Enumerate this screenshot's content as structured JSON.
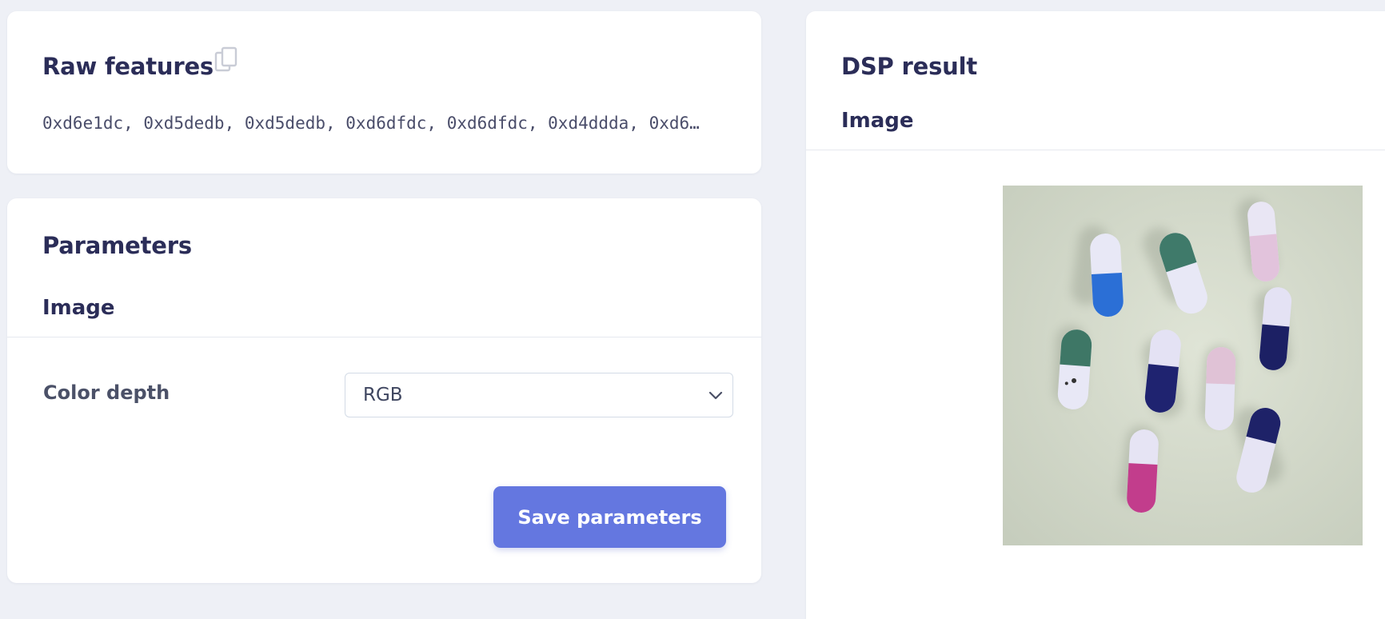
{
  "raw_features": {
    "title": "Raw features",
    "values_text": "0xd6e1dc, 0xd5dedb, 0xd5dedb, 0xd6dfdc, 0xd6dfdc, 0xd4ddda, 0xd6…"
  },
  "parameters": {
    "title": "Parameters",
    "section": "Image",
    "color_depth": {
      "label": "Color depth",
      "value": "RGB"
    },
    "save_label": "Save parameters"
  },
  "dsp_result": {
    "title": "DSP result",
    "section": "Image"
  },
  "colors": {
    "accent": "#6477e0",
    "background": "#eef0f6",
    "heading": "#2b2d58"
  },
  "icons": {
    "copy": "copy-icon",
    "select_chevron": "chevron-down-icon"
  }
}
